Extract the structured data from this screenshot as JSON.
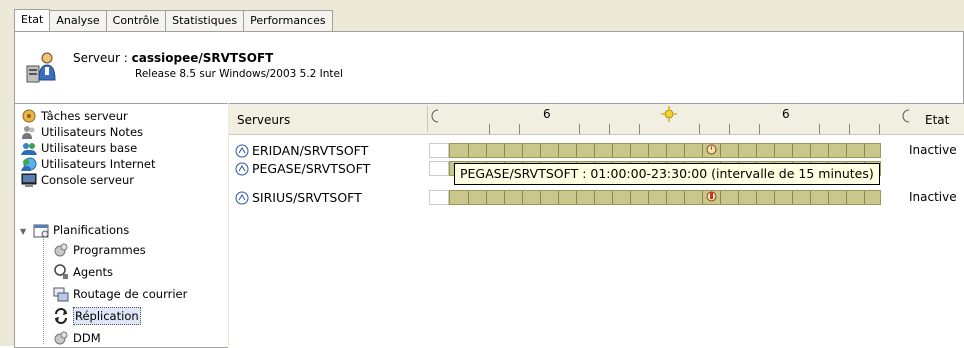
{
  "tabs": [
    {
      "label": "Etat",
      "active": true
    },
    {
      "label": "Analyse",
      "active": false
    },
    {
      "label": "Contrôle",
      "active": false
    },
    {
      "label": "Statistiques",
      "active": false
    },
    {
      "label": "Performances",
      "active": false
    }
  ],
  "server": {
    "prefix": "Serveur :",
    "name": "cassiopee/SRVTSOFT",
    "release": "Release 8.5 sur Windows/2003 5.2 Intel"
  },
  "tree": {
    "items": [
      {
        "label": "Tâches serveur",
        "icon": "tasks-icon"
      },
      {
        "label": "Utilisateurs Notes",
        "icon": "users-notes-icon"
      },
      {
        "label": "Utilisateurs base",
        "icon": "users-db-icon"
      },
      {
        "label": "Utilisateurs Internet",
        "icon": "users-internet-icon"
      },
      {
        "label": "Console serveur",
        "icon": "console-icon"
      },
      {
        "label": "Planifications",
        "icon": "schedule-icon"
      },
      {
        "label": "Programmes",
        "icon": "programs-icon"
      },
      {
        "label": "Agents",
        "icon": "agents-icon"
      },
      {
        "label": "Routage de courrier",
        "icon": "mail-routing-icon"
      },
      {
        "label": "Réplication",
        "icon": "replication-icon",
        "selected": true
      },
      {
        "label": "DDM",
        "icon": "ddm-icon"
      }
    ]
  },
  "grid": {
    "col_servers": "Serveurs",
    "col_state": "Etat",
    "tick_labels": [
      "6",
      "6"
    ],
    "rows": [
      {
        "name": "ERIDAN/SRVTSOFT",
        "state": "Inactive"
      },
      {
        "name": "PEGASE/SRVTSOFT",
        "state": ""
      },
      {
        "name": "SIRIUS/SRVTSOFT",
        "state": "Inactive"
      }
    ],
    "tooltip": "PEGASE/SRVTSOFT :  01:00:00-23:30:00  (intervalle de 15 minutes)"
  }
}
